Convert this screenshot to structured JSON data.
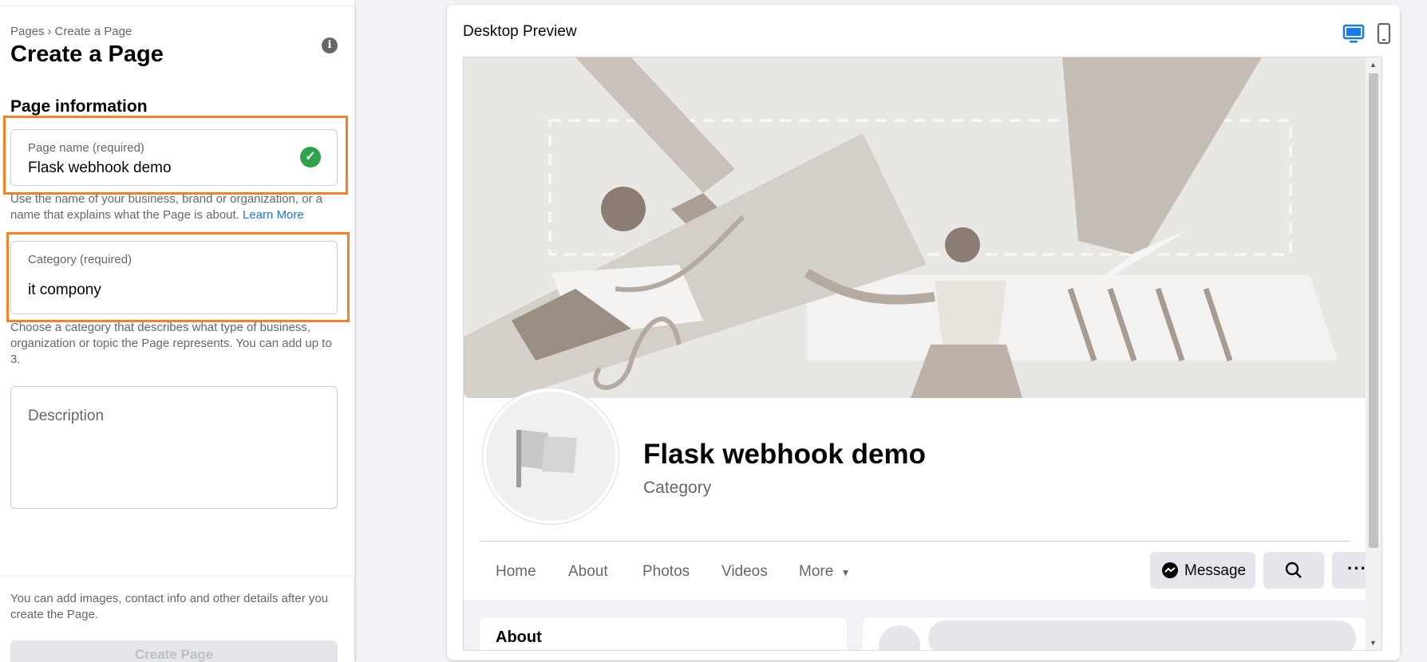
{
  "breadcrumb": {
    "root": "Pages",
    "current": "Create a Page"
  },
  "page_title": "Create a Page",
  "section_title": "Page information",
  "page_name_field": {
    "label": "Page name (required)",
    "value": "Flask webhook demo"
  },
  "page_name_help": {
    "text": "Use the name of your business, brand or organization, or a name that explains what the Page is about.",
    "link": "Learn More"
  },
  "category_field": {
    "label": "Category (required)",
    "value": "it compony"
  },
  "category_help": "Choose a category that describes what type of business, organization or topic the Page represents. You can add up to 3.",
  "description_field": {
    "placeholder": "Description"
  },
  "footer": {
    "note": "You can add images, contact info and other details after you create the Page.",
    "create_button": "Create Page"
  },
  "preview": {
    "title": "Desktop Preview",
    "page_name": "Flask webhook demo",
    "category": "Category",
    "tabs": [
      "Home",
      "About",
      "Photos",
      "Videos",
      "More"
    ],
    "message_button": "Message",
    "about_card": "About"
  },
  "colors": {
    "highlight": "#f58025",
    "link": "#1877f2",
    "success": "#31a24c",
    "active_device": "#1877f2"
  },
  "icons": {
    "info": "info-icon",
    "check": "check-circle-icon",
    "desktop": "desktop-icon",
    "mobile": "mobile-icon",
    "messenger": "messenger-icon",
    "search": "search-icon",
    "more": "more-dots-icon",
    "dropdown": "caret-down-icon",
    "flag": "flag-icon"
  }
}
